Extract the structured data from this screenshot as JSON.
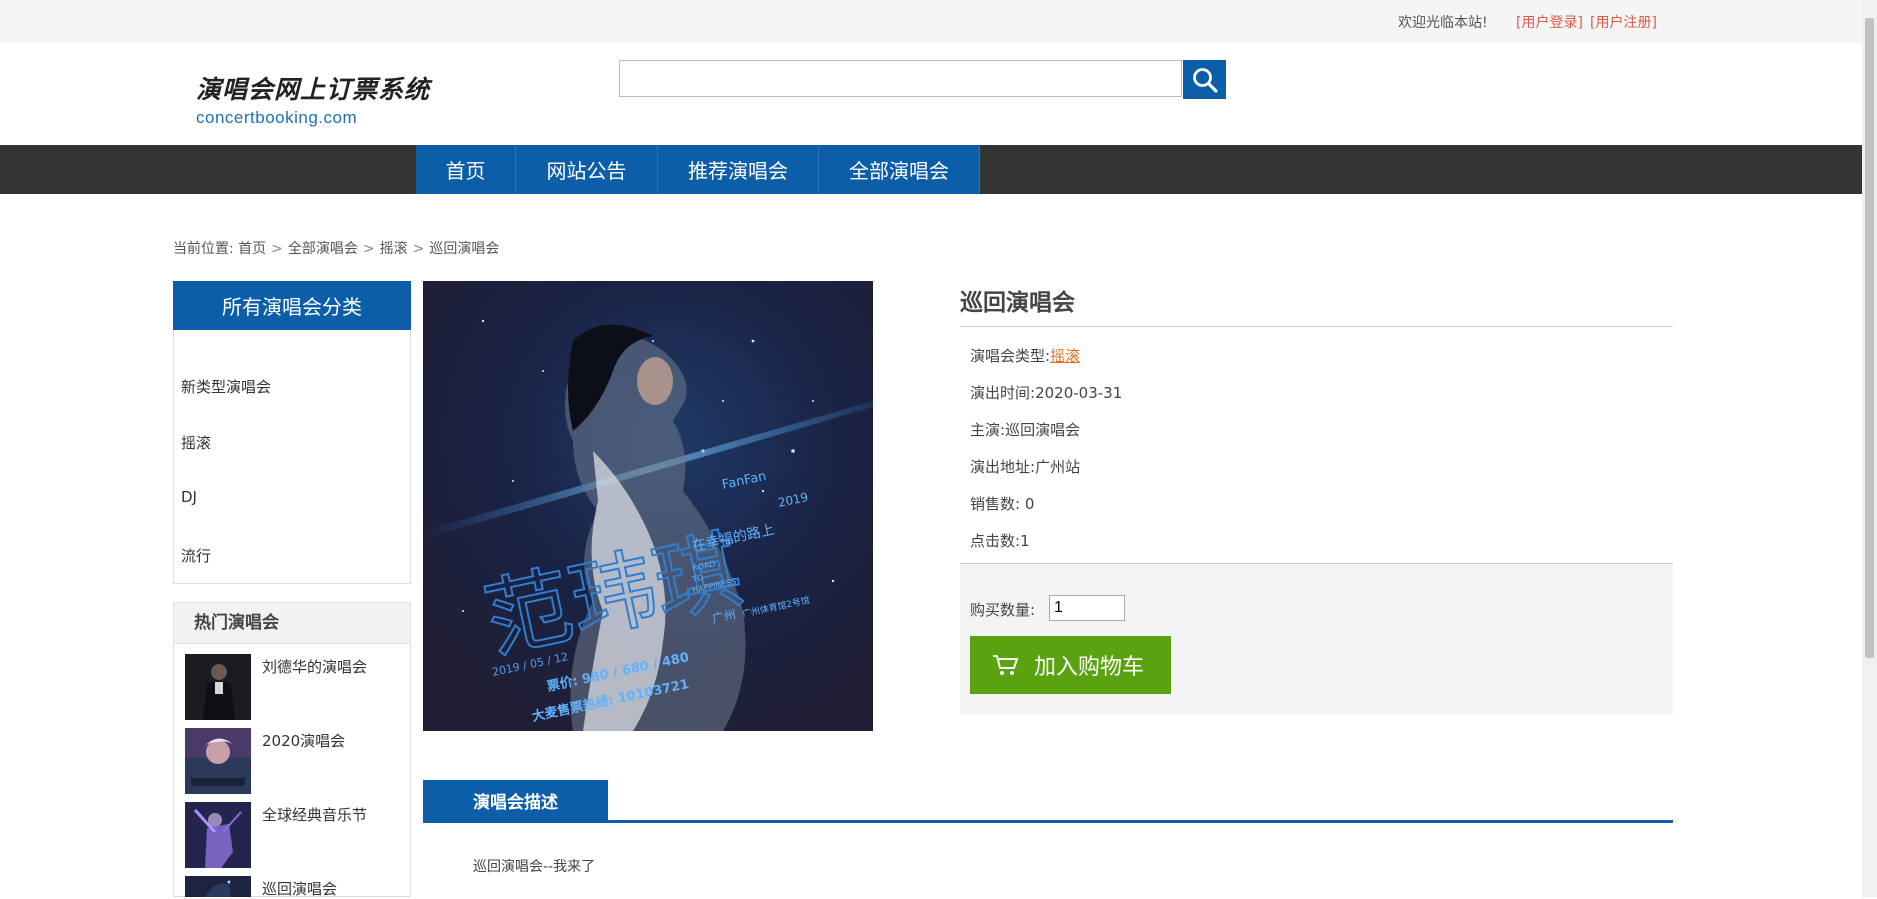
{
  "topbar": {
    "welcome": "欢迎光临本站!",
    "login_link": "[用户登录]",
    "register_link": "[用户注册]"
  },
  "header": {
    "logo_cn": "演唱会网上订票系统",
    "logo_en": "concertbooking.com",
    "search_value": "",
    "search_icon": "search-icon"
  },
  "nav": {
    "items": [
      {
        "label": "首页"
      },
      {
        "label": "网站公告"
      },
      {
        "label": "推荐演唱会"
      },
      {
        "label": "全部演唱会"
      }
    ]
  },
  "breadcrumb": {
    "prefix": "当前位置:",
    "items": [
      "首页",
      "全部演唱会",
      "摇滚",
      "巡回演唱会"
    ]
  },
  "sidebar": {
    "categories_title": "所有演唱会分类",
    "categories": [
      "新类型演唱会",
      "摇滚",
      "DJ",
      "流行"
    ],
    "hot_title": "热门演唱会",
    "hot_items": [
      {
        "title": "刘德华的演唱会"
      },
      {
        "title": "2020演唱会"
      },
      {
        "title": "全球经典音乐节"
      },
      {
        "title": "巡回演唱会"
      }
    ]
  },
  "poster": {
    "title_cn": "范玮琪",
    "en_name": "FanFan",
    "year": "2019",
    "tour_cn": "在幸福的路上",
    "tour_en_1": "ROAD",
    "tour_en_2": "TO",
    "tour_en_3": "HAPPINESS",
    "city": "广州",
    "venue": "广州体育馆2号馆",
    "date": "2019 / 05 / 12",
    "price_line": "票价: 980 / 680 / 480",
    "hotline": "大麦售票热线: 10103721"
  },
  "detail": {
    "title": "巡回演唱会",
    "type_label": "演唱会类型:",
    "type_value": "摇滚",
    "time_label": "演出时间:",
    "time_value": "2020-03-31",
    "performer_label": "主演:",
    "performer_value": "巡回演唱会",
    "address_label": "演出地址:",
    "address_value": "广州站",
    "sales_label": "销售数:",
    "sales_value": "0",
    "clicks_label": "点击数:",
    "clicks_value": "1",
    "qty_label": "购买数量:",
    "qty_value": "1",
    "cart_button": "加入购物车",
    "cart_icon": "cart-icon"
  },
  "description": {
    "tab_label": "演唱会描述",
    "text": "巡回演唱会--我来了"
  },
  "colors": {
    "brand_blue": "#0d5ea8",
    "nav_dark": "#333333",
    "cart_green": "#5aa210",
    "link_red": "#e05a4a",
    "type_orange": "#e07020"
  }
}
